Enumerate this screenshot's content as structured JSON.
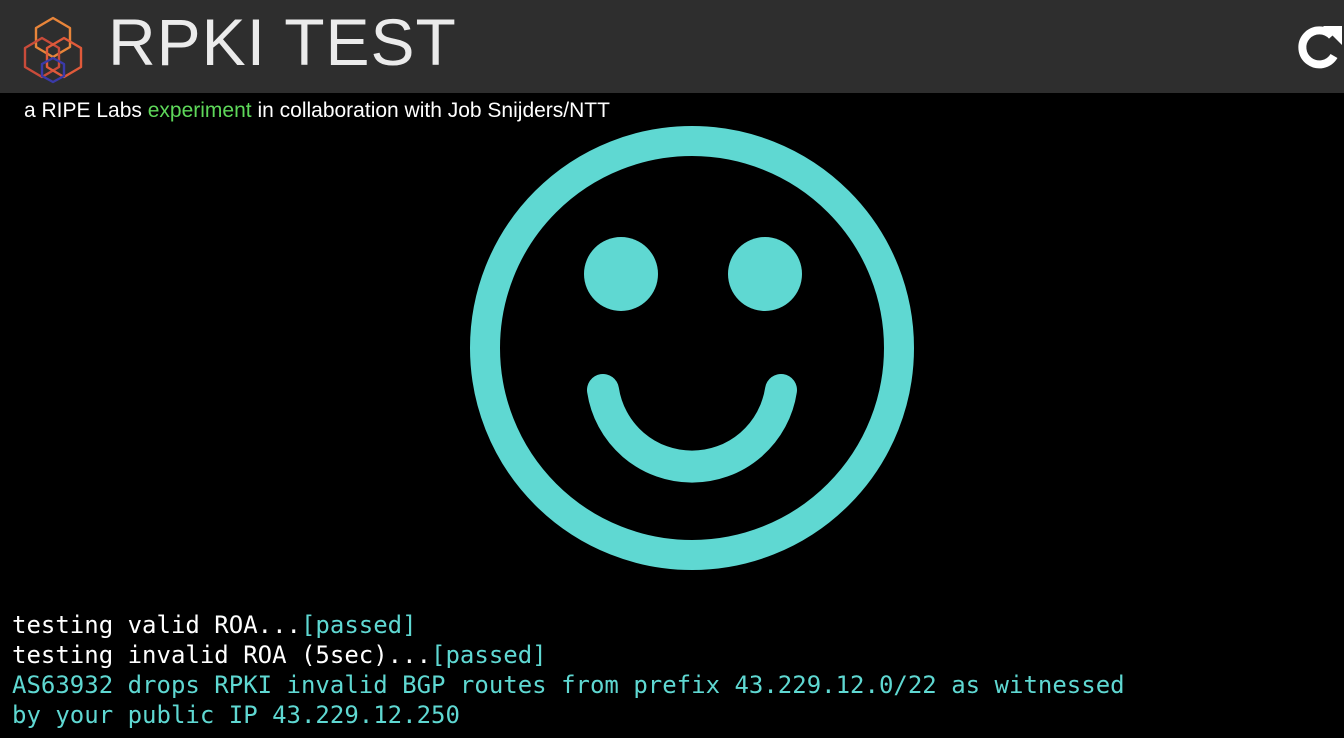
{
  "header": {
    "title": "RPKI TEST",
    "logo_icon": "ripe-hexagon-logo-icon",
    "refresh_icon": "refresh-icon",
    "background_color": "#2e2e2e"
  },
  "subtitle": {
    "prefix": "a RIPE Labs ",
    "link": "experiment",
    "suffix": " in collaboration with Job Snijders/NTT",
    "link_color": "#5ed85a"
  },
  "result": {
    "icon": "smiley-face-icon",
    "color": "#5fd8d2"
  },
  "console": {
    "test1_label": "testing valid ROA...",
    "test1_status": "[passed]",
    "test2_label": "testing invalid ROA (5sec)...",
    "test2_status": "[passed]",
    "summary_line1": "AS63932 drops RPKI invalid BGP routes from prefix 43.229.12.0/22 as witnessed",
    "summary_line2": "by your public IP 43.229.12.250"
  }
}
